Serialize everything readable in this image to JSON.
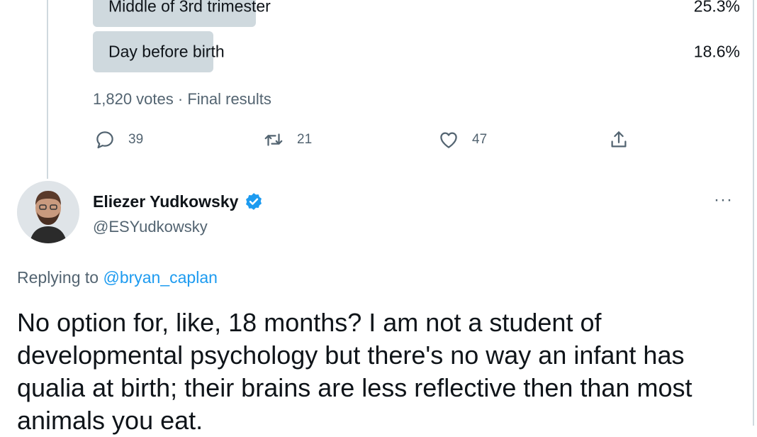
{
  "poll": {
    "options": [
      {
        "label": "Middle of 3rd trimester",
        "percent": "25.3%"
      },
      {
        "label": "Day before birth",
        "percent": "18.6%"
      }
    ],
    "votes": "1,820 votes",
    "separator": "·",
    "status": "Final results"
  },
  "actions": {
    "replies": "39",
    "retweets": "21",
    "likes": "47"
  },
  "author": {
    "name": "Eliezer Yudkowsky",
    "handle": "@ESYudkowsky",
    "more": "···"
  },
  "reply": {
    "prefix": "Replying to",
    "mention": "@bryan_caplan",
    "text": "No option for, like, 18 months?  I am not a student of developmental psychology but there's no way an infant has qualia at birth; their brains are less reflective then than most animals you eat."
  },
  "colors": {
    "accent": "#1d9bf0",
    "text": "#0f1419",
    "muted": "#536471",
    "poll_bar": "#cfd9de"
  }
}
